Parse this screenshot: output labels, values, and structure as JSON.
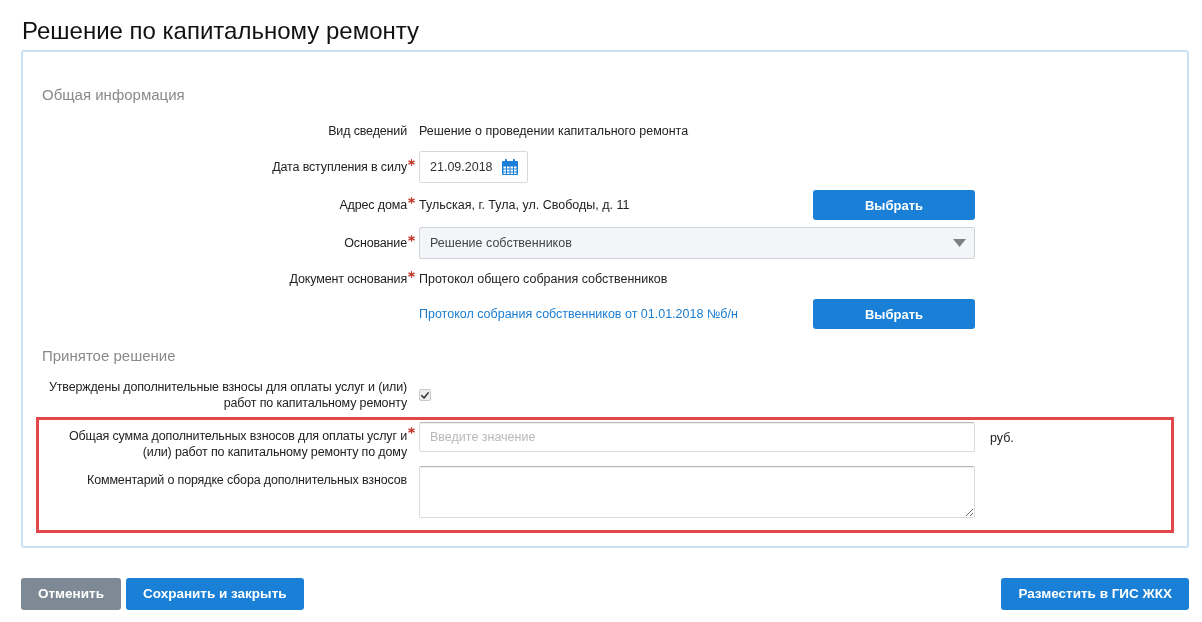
{
  "title": "Решение по капитальному ремонту",
  "sections": [
    {
      "heading": "Общая информация",
      "fields": [
        {
          "kind": "text",
          "label": "Вид сведений",
          "required": false,
          "value": "Решение о проведении капитального ремонта"
        },
        {
          "kind": "date",
          "label": "Дата вступления в силу",
          "required": true,
          "value": "21.09.2018"
        },
        {
          "kind": "text",
          "label": "Адрес дома",
          "required": true,
          "value": "Тульская, г. Тула, ул. Свободы, д. 11",
          "action": "Выбрать"
        },
        {
          "kind": "select",
          "label": "Основание",
          "required": true,
          "value": "Решение собственников"
        },
        {
          "kind": "text",
          "label": "Документ основания",
          "required": true,
          "value": "Протокол общего собрания собственников"
        },
        {
          "kind": "link",
          "value": "Протокол собрания собственников от 01.01.2018 №б/н",
          "action": "Выбрать"
        }
      ]
    },
    {
      "heading": "Принятое решение",
      "fields": [
        {
          "kind": "checkbox",
          "label": "Утверждены дополнительные взносы для оплаты услуг и (или) работ по капитальному ремонту",
          "required": false,
          "checked": true,
          "highlighted": false
        },
        {
          "kind": "number",
          "label": "Общая сумма дополнительных взносов для оплаты услуг и (или) работ по капитальному ремонту по дому",
          "required": true,
          "placeholder": "Введите значение",
          "unit": "руб.",
          "highlighted": true
        },
        {
          "kind": "textarea",
          "label": "Комментарий о порядке сбора дополнительных взносов",
          "required": false,
          "highlighted": true
        }
      ]
    }
  ],
  "footer": {
    "left": [
      {
        "label": "Отменить",
        "kind": "secondary"
      },
      {
        "label": "Сохранить и закрыть",
        "kind": "primary"
      }
    ],
    "right": [
      {
        "label": "Разместить в ГИС ЖКХ",
        "kind": "primary"
      }
    ]
  }
}
